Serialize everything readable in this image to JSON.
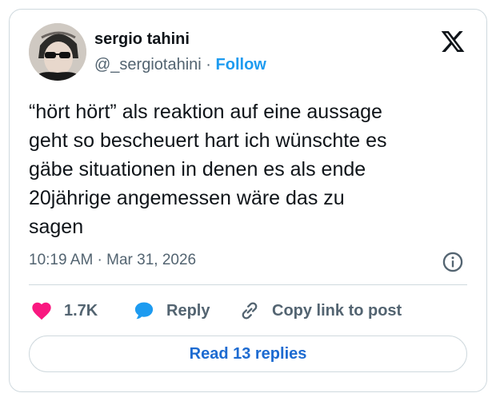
{
  "author": {
    "display_name": "sergio tahini",
    "handle": "@_sergiotahini",
    "separator": "·",
    "follow_label": "Follow"
  },
  "tweet": {
    "text": "“hört hört” als reaktion auf eine aussage\ngeht so bescheuert hart ich wünschte es\ngäbe situationen in denen es als ende\n20jährige angemessen wäre das zu\nsagen",
    "timestamp": "10:19 AM · Mar 31, 2026"
  },
  "actions": {
    "like_count": "1.7K",
    "reply_label": "Reply",
    "copy_label": "Copy link to post"
  },
  "read_replies_label": "Read 13 replies",
  "colors": {
    "accent": "#1d9bf0",
    "like": "#f91880",
    "reply_icon": "#1d9bf0",
    "muted_text": "#536471",
    "border": "#cfd9de"
  },
  "icons": {
    "brand": "x-logo-icon",
    "like": "heart-icon",
    "reply": "speech-bubble-icon",
    "copy": "link-icon",
    "info": "info-icon"
  }
}
